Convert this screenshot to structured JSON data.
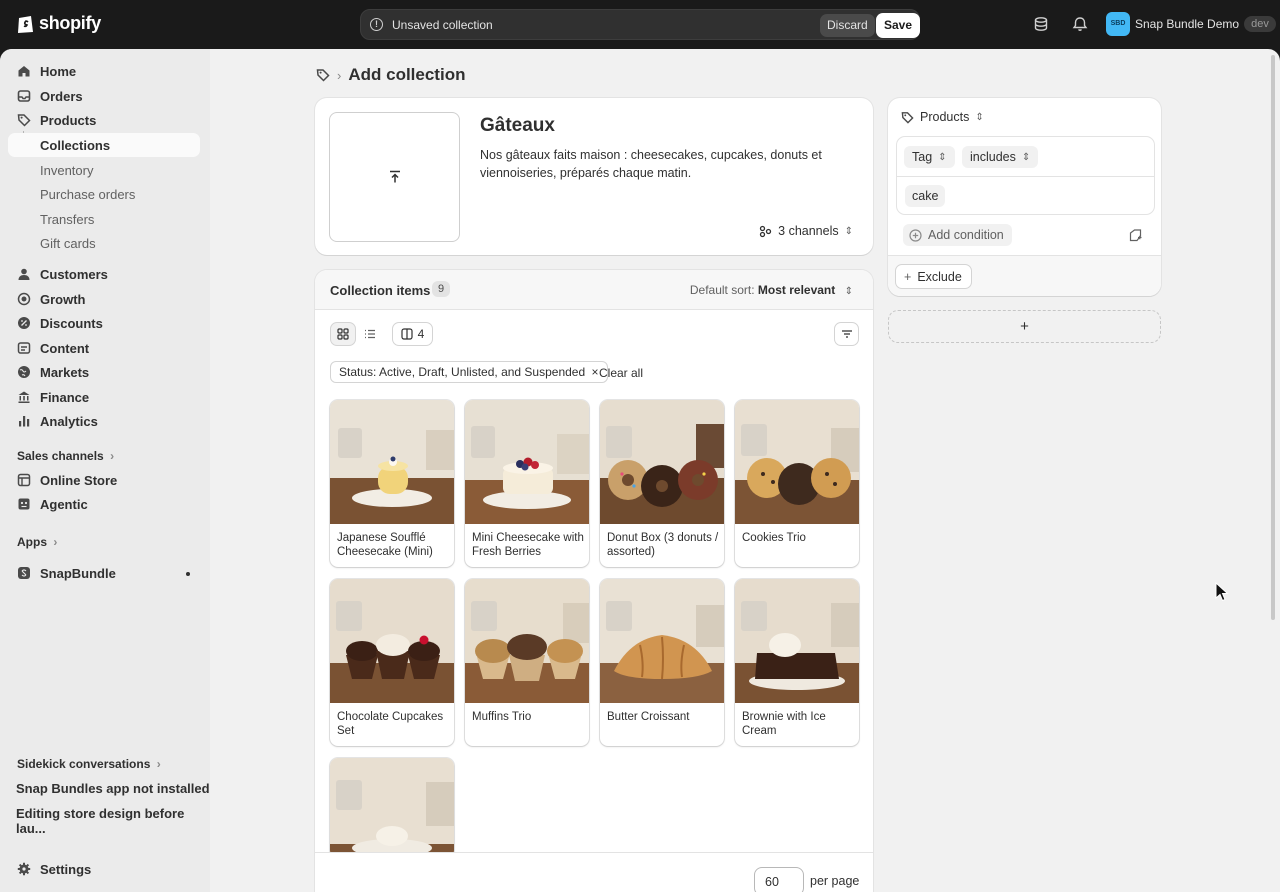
{
  "brand": "shopify",
  "savebar": {
    "message": "Unsaved collection",
    "discard": "Discard",
    "save": "Save"
  },
  "store": {
    "initials": "SBD",
    "name": "Snap Bundle Demo",
    "env": "dev"
  },
  "nav": {
    "main": [
      "Home",
      "Orders",
      "Products"
    ],
    "products_sub": [
      "Collections",
      "Inventory",
      "Purchase orders",
      "Transfers",
      "Gift cards"
    ],
    "secondary": [
      "Customers",
      "Growth",
      "Discounts",
      "Content",
      "Markets",
      "Finance",
      "Analytics"
    ],
    "sales_channels_label": "Sales channels",
    "sales_channels": [
      "Online Store",
      "Agentic"
    ],
    "apps_label": "Apps",
    "apps": [
      "SnapBundle"
    ],
    "sidekick_label": "Sidekick conversations",
    "sidekick": [
      "Snap Bundles app not installed",
      "Editing store design before lau..."
    ],
    "settings": "Settings"
  },
  "page": {
    "title": "Add collection"
  },
  "collection": {
    "title": "Gâteaux",
    "description": "Nos gâteaux faits maison : cheesecakes, cupcakes, donuts et viennoiseries, préparés chaque matin.",
    "channels": "3 channels"
  },
  "items": {
    "title": "Collection items",
    "count": "9",
    "sort_label": "Default sort:",
    "sort_value": "Most relevant",
    "columns": "4",
    "filter_chip": "Status: Active, Draft, Unlisted, and Suspended",
    "clear_all": "Clear all",
    "products": [
      "Japanese Soufflé Cheesecake (Mini)",
      "Mini Cheesecake with Fresh Berries",
      "Donut Box (3 donuts / assorted)",
      "Cookies Trio",
      "Chocolate Cupcakes Set",
      "Muffins Trio",
      "Butter Croissant",
      "Brownie with Ice Cream",
      ""
    ],
    "per_page": "60",
    "per_page_label": "per page"
  },
  "rules": {
    "heading": "Products",
    "field": "Tag",
    "operator": "includes",
    "value": "cake",
    "add_condition": "Add condition",
    "exclude": "Exclude",
    "add_block": "+"
  },
  "colors": {
    "topbar": "#1a1a1a",
    "frame": "#f1f1f1",
    "sidebar": "#ebebeb",
    "card": "#ffffff",
    "avatar": "#42b8f5"
  }
}
